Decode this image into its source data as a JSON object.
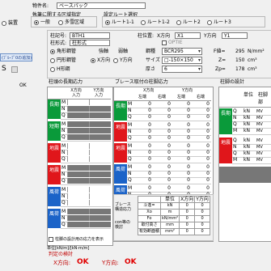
{
  "header": {
    "property_name_label": "物件名:",
    "property_name_value": "ベースパック",
    "building_class_label": "執筆に関する区域指定",
    "building_class_options": [
      "一般",
      "多雪区域"
    ],
    "stud_type_label": "設定ルート選択",
    "route_options": [
      "ルート1-1",
      "ルート1-2",
      "ルート2",
      "ルート3"
    ],
    "equipment_radio": "装置",
    "left_tab": "(ﾌﾞﾙｰﾌﾟ0の追加)",
    "left_glyph": "S",
    "left_value": "OK"
  },
  "col_section": {
    "col_name_label": "柱記号:",
    "col_name_value": "BTH1",
    "col_spec_label": "柱形式:",
    "col_spec_value": "柱形式",
    "pos_label": "柱位置:",
    "x_label": "X方向",
    "x_value": "X1",
    "y_label": "Y方向",
    "y_value": "Y1",
    "shape_options": [
      "角形鋼管",
      "円形鋼管",
      "H形鋼"
    ],
    "strength_label": "強軸",
    "weak_label": "弱軸",
    "xdir_label": "X方向",
    "ydir_label": "Y方向",
    "material_label": "鋼種",
    "material_value": "BCR295",
    "size_label": "サイズ",
    "size_value": "□-150×150",
    "thick_label": "厚さ",
    "thick_value": "6",
    "fixed_label": "OPTIE",
    "fy_label": "F値=",
    "fy_value": "295",
    "fy_unit": "N/mm²",
    "z_label": "Z=",
    "z_value": "150",
    "z_unit": "cm³",
    "zp_label": "Zp=",
    "zp_value": "178",
    "zp_unit": "cm³"
  },
  "col_stress": {
    "title": "柱頭の長期応力",
    "headers": [
      "",
      "X方向\n入力",
      "Y方向\n入力"
    ],
    "rows": [
      {
        "tag": "長期",
        "color": "green",
        "lines": [
          "M",
          "N",
          "Q"
        ]
      },
      {
        "tag": "短期",
        "color": "green",
        "lines": [
          "M",
          "N",
          "Q"
        ]
      },
      {
        "tag": "地震",
        "color": "red",
        "lines": [
          "M",
          "N",
          "Q"
        ]
      },
      {
        "tag": "地震",
        "color": "red",
        "lines": [
          "M",
          "N",
          "Q"
        ]
      },
      {
        "tag": "風荷",
        "color": "blue",
        "lines": [
          "M",
          "N",
          "Q"
        ]
      },
      {
        "tag": "風荷",
        "color": "blue",
        "lines": [
          "M",
          "N",
          "Q"
        ]
      }
    ],
    "note": "柱脚の設計用の応力を表示",
    "unit_label": "単位[kN/m]/[kN·m/m]"
  },
  "brace_stress": {
    "title": "ブレース取付の柱脚応力",
    "headers": [
      "",
      "X方向",
      "Y方向"
    ],
    "subheaders": [
      "",
      "左端",
      "右端",
      "左端",
      "右端"
    ],
    "rows": [
      {
        "tag": "長期",
        "color": "green",
        "lines": [
          [
            "M",
            "0",
            "0",
            "0",
            "0"
          ],
          [
            "N",
            "0",
            "0",
            "0",
            "0"
          ],
          [
            "Q",
            "0",
            "0",
            "0",
            "0"
          ]
        ]
      },
      {
        "tag": "地震",
        "color": "red",
        "lines": [
          [
            "M",
            "0",
            "0",
            "0",
            "0"
          ],
          [
            "N",
            "0",
            "0",
            "0",
            "0"
          ],
          [
            "Q",
            "0",
            "0",
            "0",
            "0"
          ]
        ]
      },
      {
        "tag": "地震",
        "color": "red",
        "lines": [
          [
            "M",
            "0",
            "0",
            "0",
            "0"
          ],
          [
            "N",
            "0",
            "0",
            "0",
            "0"
          ],
          [
            "Q",
            "0",
            "0",
            "0",
            "0"
          ]
        ]
      },
      {
        "tag": "風荷",
        "color": "blue",
        "lines": [
          [
            "M",
            "0",
            "0",
            "0",
            "0"
          ],
          [
            "N",
            "0",
            "0",
            "0",
            "0"
          ],
          [
            "Q",
            "0",
            "0",
            "0",
            "0"
          ]
        ]
      },
      {
        "tag": "風荷",
        "color": "blue",
        "lines": [
          [
            "M",
            "0",
            "0",
            "0",
            "0"
          ],
          [
            "N",
            "0",
            "0",
            "0",
            "0"
          ],
          [
            "Q",
            "0",
            "0",
            "0",
            "0"
          ]
        ]
      }
    ],
    "summary": {
      "brace_label": "ブレース\n構造応力",
      "con_label": "con等の\n検討",
      "col_headers": [
        "",
        "単位",
        "X方向",
        "Y方向"
      ],
      "rows": [
        [
          "斗逢=",
          "kN",
          "0",
          "0"
        ],
        [
          "Xo",
          "m",
          "0",
          "0"
        ],
        [
          "Fo",
          "kN/mm²",
          "0",
          "0"
        ],
        [
          "取付高さ",
          "mm",
          "0",
          "0"
        ],
        [
          "有効断面積",
          "mm²",
          "0",
          "0"
        ]
      ]
    }
  },
  "base_stress": {
    "title": "柱脚の設計",
    "unit_col": "単位",
    "sub_col": "柱脚部",
    "rows": [
      {
        "tag": "長期",
        "color": "green",
        "lines": [
          [
            "Q",
            "kN"
          ],
          [
            "N",
            "kN"
          ],
          [
            "Q",
            "kN"
          ],
          [
            "M",
            "kN"
          ]
        ]
      },
      {
        "tag": "地震",
        "color": "red",
        "lines": [
          [
            "Q",
            "kN"
          ],
          [
            "N",
            "kN"
          ],
          [
            "Q",
            "kN"
          ],
          [
            "M",
            "kN"
          ]
        ]
      }
    ],
    "mv_label": "MV"
  },
  "judgement": {
    "title": "判定の検討",
    "x_label": "X方向:",
    "x_value": "OK",
    "y_label": "Y方向:",
    "y_value": "OK"
  }
}
